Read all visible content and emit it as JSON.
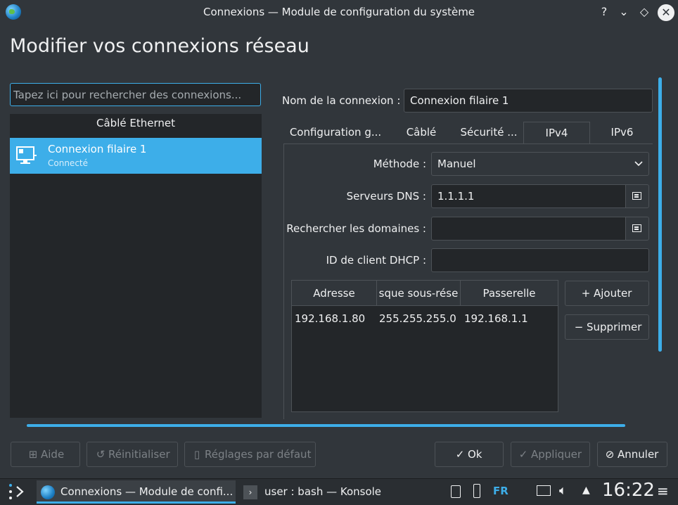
{
  "window": {
    "title": "Connexions — Module de configuration du système",
    "help_glyph": "?",
    "minimize_glyph": "⌄",
    "maximize_glyph": "◇",
    "close_glyph": "✕"
  },
  "page_title": "Modifier vos connexions réseau",
  "search": {
    "placeholder": "Tapez ici pour rechercher des connexions..."
  },
  "connection_list": {
    "group_header": "Câblé Ethernet",
    "items": [
      {
        "name": "Connexion filaire 1",
        "status": "Connecté",
        "selected": true
      }
    ]
  },
  "connection_name": {
    "label": "Nom de la connexion :",
    "value": "Connexion filaire 1"
  },
  "tabs": [
    {
      "label": "Configuration g...",
      "active": false
    },
    {
      "label": "Câblé",
      "active": false
    },
    {
      "label": "Sécurité ...",
      "active": false
    },
    {
      "label": "IPv4",
      "active": true
    },
    {
      "label": "IPv6",
      "active": false
    }
  ],
  "ipv4": {
    "method_label": "Méthode :",
    "method_value": "Manuel",
    "dns_label": "Serveurs DNS :",
    "dns_value": "1.1.1.1",
    "search_domains_label": "Rechercher les domaines :",
    "search_domains_value": "",
    "dhcp_id_label": "ID de client DHCP :",
    "dhcp_id_value": "",
    "table": {
      "columns": [
        "Adresse",
        "sque sous-rése",
        "Passerelle"
      ],
      "rows": [
        [
          "192.168.1.80",
          "255.255.255.0",
          "192.168.1.1"
        ]
      ]
    },
    "add_label": "Ajouter",
    "remove_label": "Supprimer"
  },
  "footer": {
    "help": "Aide",
    "reset": "Réinitialiser",
    "defaults": "Réglages par défaut",
    "ok": "Ok",
    "apply": "Appliquer",
    "cancel": "Annuler"
  },
  "taskbar": {
    "tasks": [
      "Connexions — Module de confi...",
      "user : bash — Konsole"
    ],
    "keyboard_layout": "FR",
    "clock": "16:22"
  },
  "colors": {
    "accent": "#3daee9",
    "background": "#31363b",
    "field": "#232629"
  }
}
